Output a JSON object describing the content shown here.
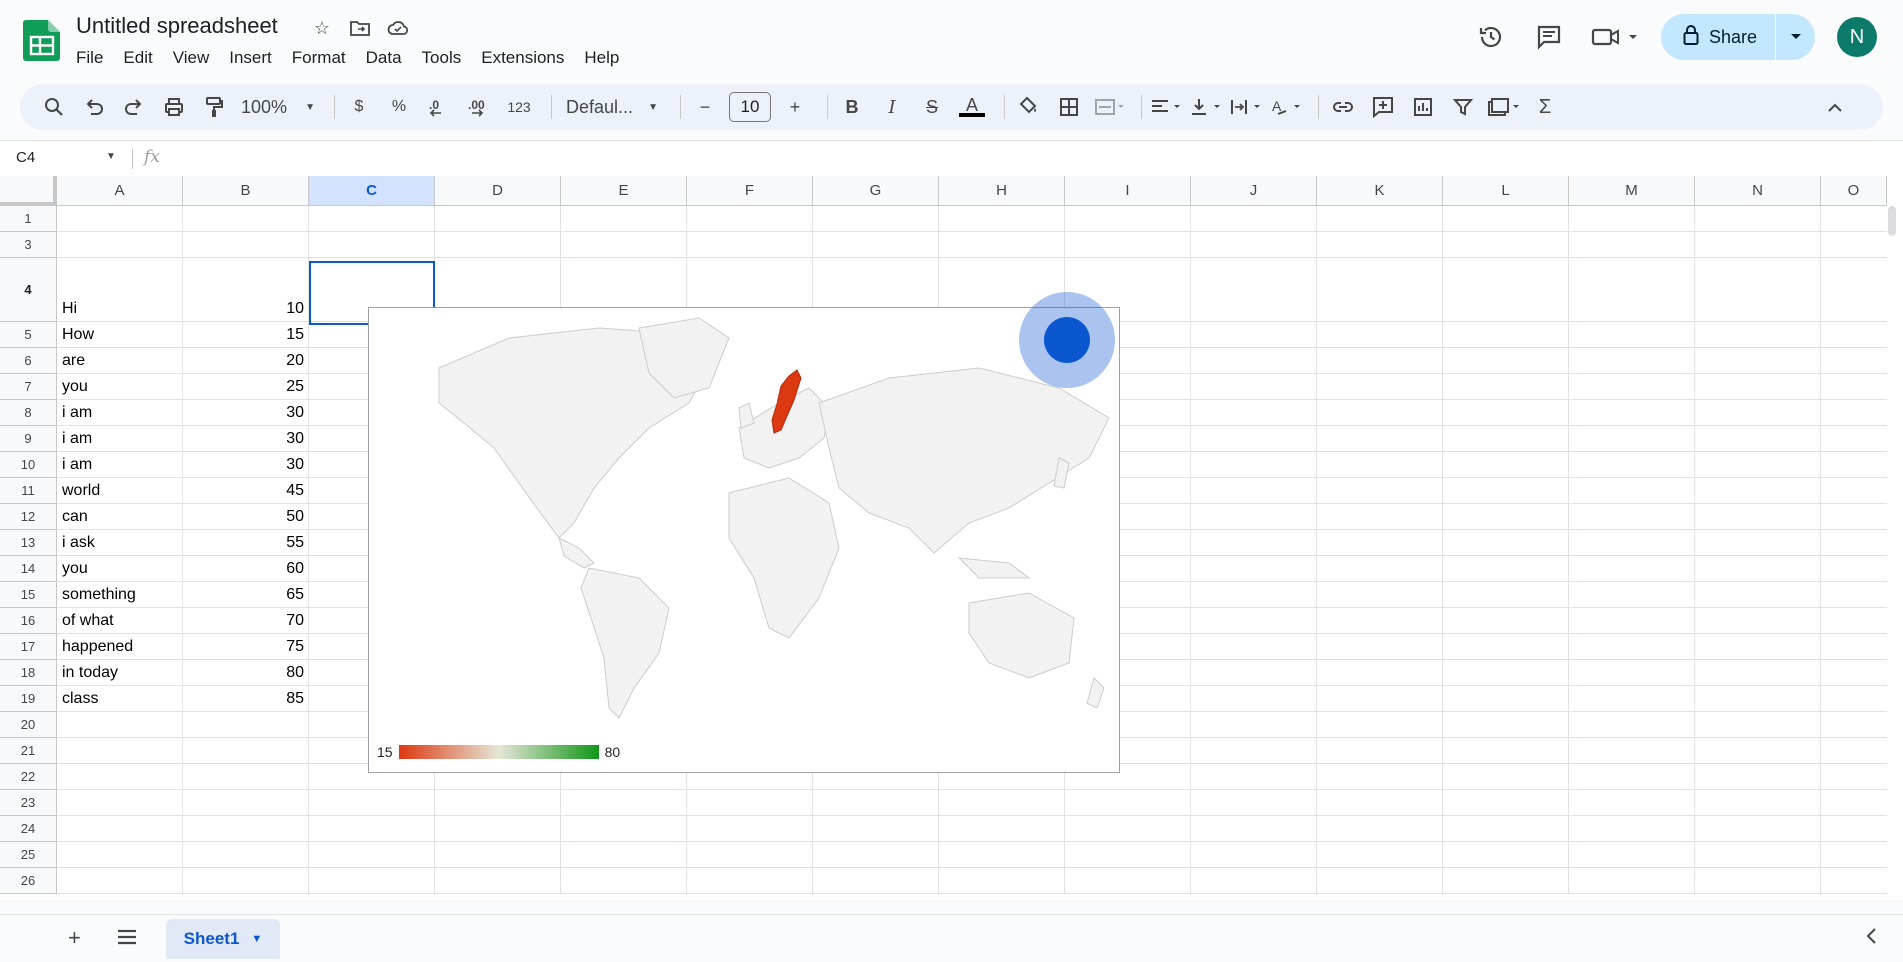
{
  "app": {
    "title": "Untitled spreadsheet"
  },
  "menu": [
    "File",
    "Edit",
    "View",
    "Insert",
    "Format",
    "Data",
    "Tools",
    "Extensions",
    "Help"
  ],
  "header": {
    "share_label": "Share",
    "avatar_letter": "N"
  },
  "toolbar": {
    "zoom": "100%",
    "currency": "$",
    "percent": "%",
    "dec_dec": ".0",
    "inc_dec": ".00",
    "number_format": "123",
    "font": "Defaul...",
    "font_size": "10",
    "minus": "−",
    "plus": "+",
    "bold": "B",
    "italic": "I",
    "strike": "S",
    "text_color": "A"
  },
  "formula": {
    "cell_ref": "C4",
    "fx": "fx",
    "value": ""
  },
  "columns": [
    "A",
    "B",
    "C",
    "D",
    "E",
    "F",
    "G",
    "H",
    "I",
    "J",
    "K",
    "L",
    "M",
    "N",
    "O"
  ],
  "rows": [
    {
      "num": "1",
      "a": "",
      "b": ""
    },
    {
      "num": "3",
      "a": "",
      "b": ""
    },
    {
      "num": "4",
      "a": "Hi",
      "b": "10"
    },
    {
      "num": "5",
      "a": "How",
      "b": "15"
    },
    {
      "num": "6",
      "a": "are",
      "b": "20"
    },
    {
      "num": "7",
      "a": "you",
      "b": "25"
    },
    {
      "num": "8",
      "a": "i am",
      "b": "30"
    },
    {
      "num": "9",
      "a": "i am",
      "b": "30"
    },
    {
      "num": "10",
      "a": "i am",
      "b": "30"
    },
    {
      "num": "11",
      "a": "world",
      "b": "45"
    },
    {
      "num": "12",
      "a": "can",
      "b": "50"
    },
    {
      "num": "13",
      "a": "i ask",
      "b": "55"
    },
    {
      "num": "14",
      "a": "you",
      "b": "60"
    },
    {
      "num": "15",
      "a": "something",
      "b": "65"
    },
    {
      "num": "16",
      "a": "of what",
      "b": "70"
    },
    {
      "num": "17",
      "a": "happened",
      "b": "75"
    },
    {
      "num": "18",
      "a": "in today",
      "b": "80"
    },
    {
      "num": "19",
      "a": "class",
      "b": "85"
    },
    {
      "num": "20",
      "a": "",
      "b": ""
    },
    {
      "num": "21",
      "a": "",
      "b": ""
    },
    {
      "num": "22",
      "a": "",
      "b": ""
    },
    {
      "num": "23",
      "a": "",
      "b": ""
    },
    {
      "num": "24",
      "a": "",
      "b": ""
    },
    {
      "num": "25",
      "a": "",
      "b": ""
    },
    {
      "num": "26",
      "a": "",
      "b": ""
    }
  ],
  "chart_data": {
    "type": "geo",
    "highlighted_region": "Sweden",
    "colors": {
      "min": "#dc3912",
      "mid": "#e6e6d6",
      "max": "#109618",
      "region": "#dc3912",
      "land": "#f2f2f2",
      "border": "#cccccc"
    },
    "legend": {
      "min": "15",
      "max": "80"
    }
  },
  "sheets": [
    {
      "name": "Sheet1",
      "active": true
    }
  ],
  "accent": "#0b57d0"
}
